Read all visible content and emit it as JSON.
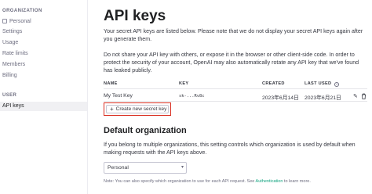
{
  "sidebar": {
    "org_section": "ORGANIZATION",
    "org_name": "Personal",
    "items": [
      "Settings",
      "Usage",
      "Rate limits",
      "Members",
      "Billing"
    ],
    "user_section": "USER",
    "user_items": [
      "API keys"
    ]
  },
  "page": {
    "title": "API keys",
    "intro": "Your secret API keys are listed below. Please note that we do not display your secret API keys again after you generate them.",
    "warning": "Do not share your API key with others, or expose it in the browser or other client-side code. In order to protect the security of your account, OpenAI may also automatically rotate any API key that we've found has leaked publicly."
  },
  "table": {
    "headers": [
      "NAME",
      "KEY",
      "CREATED",
      "LAST USED"
    ],
    "last_used_info_icon": "info-icon",
    "rows": [
      {
        "name": "My Test Key",
        "key": "sk-...Rv8c",
        "created": "2023年6月14日",
        "last_used": "2023年6月21日",
        "edit_icon": "pencil-icon",
        "delete_icon": "trash-icon"
      }
    ]
  },
  "create_button": {
    "icon": "plus-icon",
    "label": "Create new secret key"
  },
  "default_org": {
    "title": "Default organization",
    "description": "If you belong to multiple organizations, this setting controls which organization is used by default when making requests with the API keys above.",
    "selected": "Personal",
    "note_prefix": "Note: You can also specify which organization to use for each API request. See ",
    "note_link": "Authentication",
    "note_suffix": " to learn more."
  },
  "colors": {
    "accent_link": "#10a37f",
    "highlight_box": "#d92d20"
  }
}
